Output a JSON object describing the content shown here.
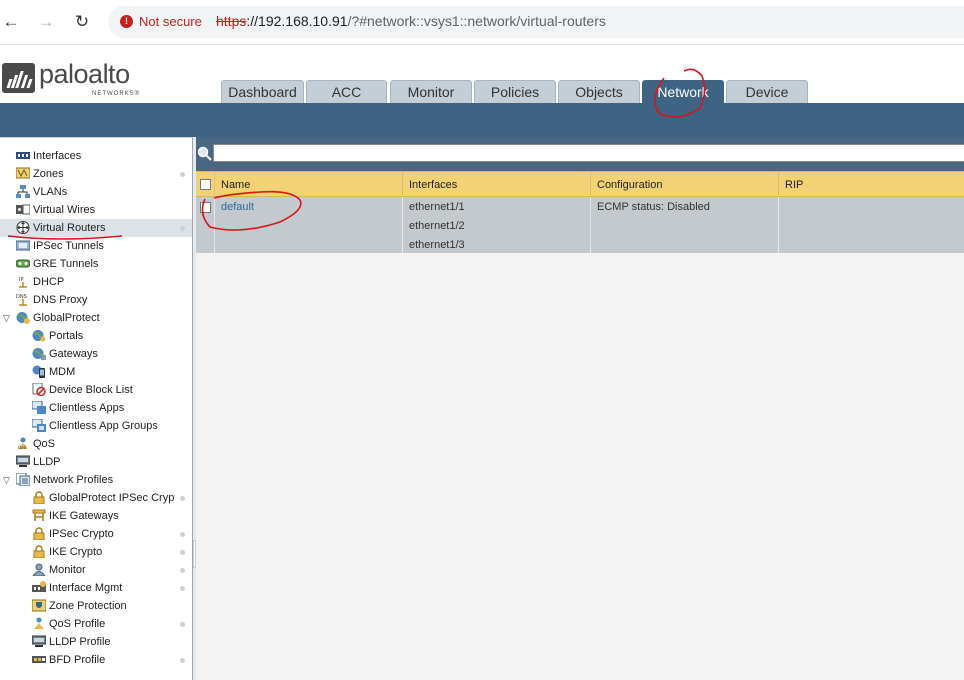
{
  "browser": {
    "security_label": "Not secure",
    "url_protocol": "https",
    "url_host": "://192.168.10.91",
    "url_rest": "/?#network::vsys1::network/virtual-routers"
  },
  "logo": {
    "name": "paloalto",
    "sub": "NETWORKS®"
  },
  "tabs": [
    {
      "label": "Dashboard"
    },
    {
      "label": "ACC"
    },
    {
      "label": "Monitor"
    },
    {
      "label": "Policies"
    },
    {
      "label": "Objects"
    },
    {
      "label": "Network",
      "active": true
    },
    {
      "label": "Device"
    }
  ],
  "sidebar": {
    "items": [
      {
        "label": "Interfaces",
        "icon": "interfaces-icon"
      },
      {
        "label": "Zones",
        "icon": "zones-icon"
      },
      {
        "label": "VLANs",
        "icon": "vlans-icon"
      },
      {
        "label": "Virtual Wires",
        "icon": "virtual-wires-icon"
      },
      {
        "label": "Virtual Routers",
        "icon": "virtual-routers-icon",
        "selected": true
      },
      {
        "label": "IPSec Tunnels",
        "icon": "ipsec-tunnels-icon"
      },
      {
        "label": "GRE Tunnels",
        "icon": "gre-tunnels-icon"
      },
      {
        "label": "DHCP",
        "icon": "dhcp-icon"
      },
      {
        "label": "DNS Proxy",
        "icon": "dns-proxy-icon"
      },
      {
        "label": "GlobalProtect",
        "icon": "globalprotect-icon"
      },
      {
        "label": "Portals",
        "icon": "portals-icon"
      },
      {
        "label": "Gateways",
        "icon": "gateways-icon"
      },
      {
        "label": "MDM",
        "icon": "mdm-icon"
      },
      {
        "label": "Device Block List",
        "icon": "device-block-list-icon"
      },
      {
        "label": "Clientless Apps",
        "icon": "clientless-apps-icon"
      },
      {
        "label": "Clientless App Groups",
        "icon": "clientless-app-groups-icon"
      },
      {
        "label": "QoS",
        "icon": "qos-icon"
      },
      {
        "label": "LLDP",
        "icon": "lldp-icon"
      },
      {
        "label": "Network Profiles",
        "icon": "network-profiles-icon"
      },
      {
        "label": "GlobalProtect IPSec Crypto",
        "icon": "lock-icon"
      },
      {
        "label": "IKE Gateways",
        "icon": "ike-gateways-icon"
      },
      {
        "label": "IPSec Crypto",
        "icon": "lock-icon"
      },
      {
        "label": "IKE Crypto",
        "icon": "lock-icon"
      },
      {
        "label": "Monitor",
        "icon": "monitor-profile-icon"
      },
      {
        "label": "Interface Mgmt",
        "icon": "interface-mgmt-icon"
      },
      {
        "label": "Zone Protection",
        "icon": "zone-protection-icon"
      },
      {
        "label": "QoS Profile",
        "icon": "qos-profile-icon"
      },
      {
        "label": "LLDP Profile",
        "icon": "lldp-profile-icon"
      },
      {
        "label": "BFD Profile",
        "icon": "bfd-profile-icon"
      }
    ]
  },
  "table": {
    "search_value": "",
    "columns": [
      "Name",
      "Interfaces",
      "Configuration",
      "RIP"
    ],
    "rows": [
      {
        "name": "default",
        "interfaces": [
          "ethernet1/1",
          "ethernet1/2",
          "ethernet1/3"
        ],
        "configuration": "ECMP status: Disabled",
        "rip": ""
      }
    ]
  },
  "colors": {
    "header_blue": "#3f6483",
    "table_header": "#f2d275",
    "row_selected": "#c3c9cc",
    "annotation_red": "#d9141c"
  }
}
